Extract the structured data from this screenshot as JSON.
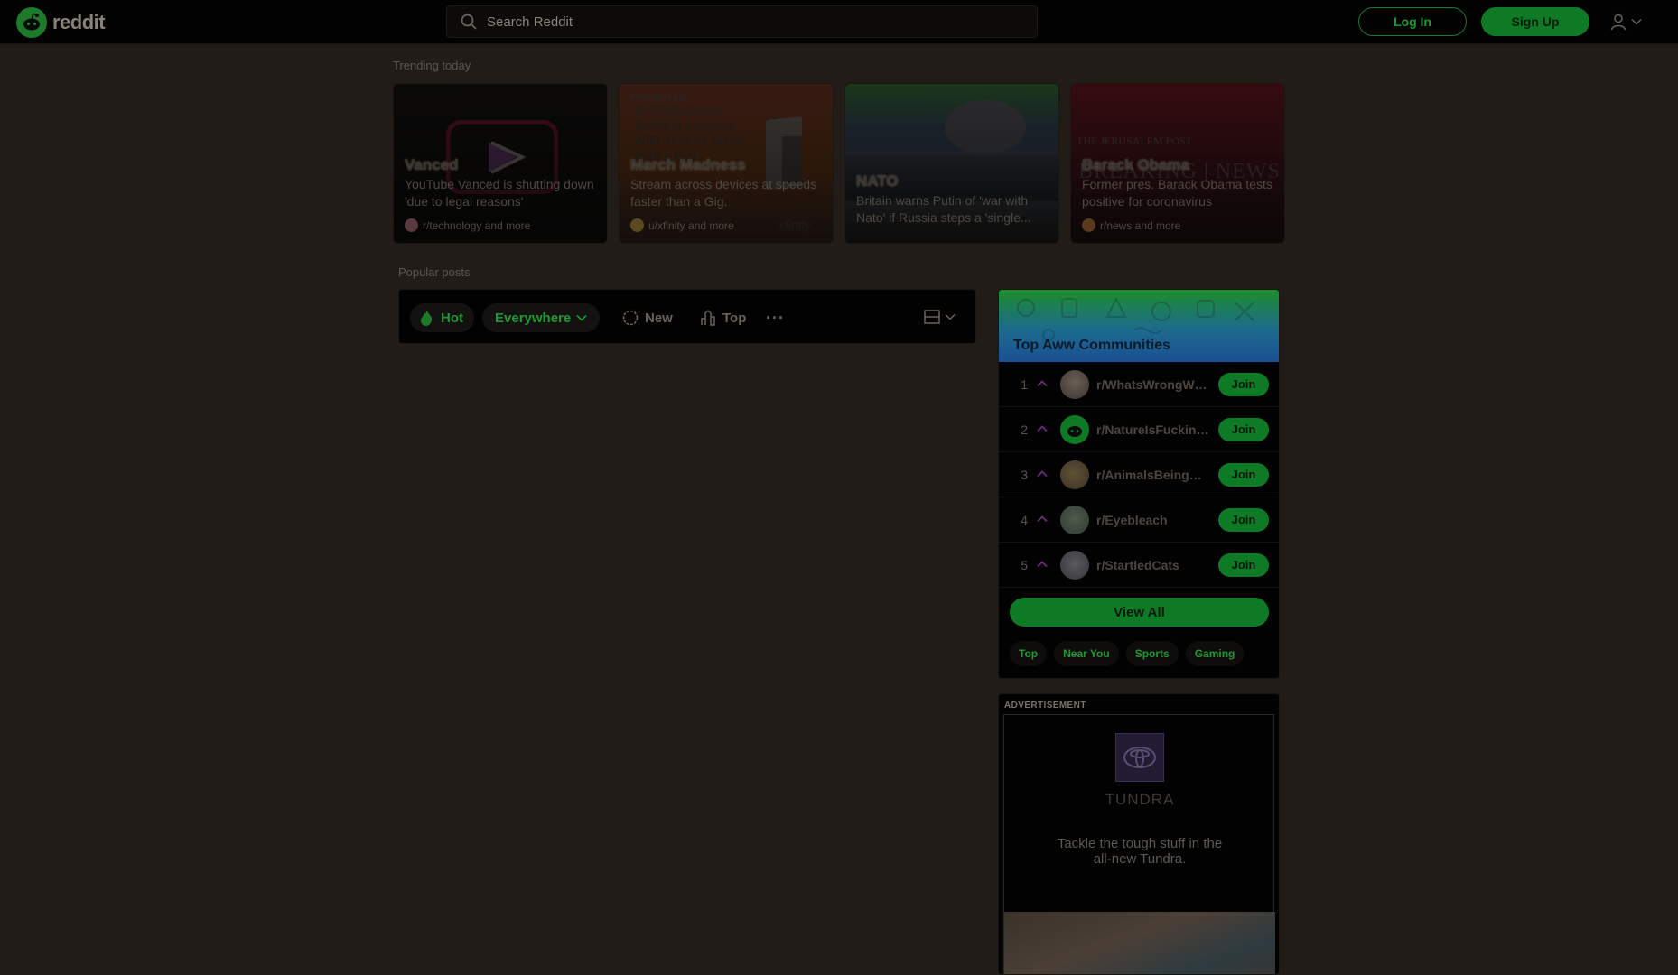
{
  "header": {
    "logo_text": "reddit",
    "search_placeholder": "Search Reddit",
    "login_label": "Log In",
    "signup_label": "Sign Up"
  },
  "trending": {
    "label": "Trending today",
    "cards": [
      {
        "title": "Vanced",
        "description": "YouTube Vanced is shutting down 'due to legal reasons'",
        "subreddit": "r/technology and more",
        "promoted": ""
      },
      {
        "title": "March Madness",
        "description": "Stream across devices at speeds faster than a Gig.",
        "subreddit": "u/xfinity and more",
        "promoted": "PROMOTED"
      },
      {
        "title": "NATO",
        "description": "Britain warns Putin of 'war with Nato' if Russia steps a 'single...",
        "subreddit": "",
        "promoted": ""
      },
      {
        "title": "Barack Obama",
        "description": "Former pres. Barack Obama tests positive for coronavirus",
        "subreddit": "r/news and more",
        "promoted": ""
      }
    ]
  },
  "popular": {
    "label": "Popular posts",
    "sort": {
      "hot": "Hot",
      "everywhere": "Everywhere",
      "new": "New",
      "top": "Top",
      "more": "···"
    }
  },
  "communities": {
    "title": "Top Aww Communities",
    "items": [
      {
        "rank": "1",
        "name": "r/WhatsWrongWithYourDog",
        "join": "Join"
      },
      {
        "rank": "2",
        "name": "r/NatureIsFuckingLit",
        "join": "Join"
      },
      {
        "rank": "3",
        "name": "r/AnimalsBeingBros",
        "join": "Join"
      },
      {
        "rank": "4",
        "name": "r/Eyebleach",
        "join": "Join"
      },
      {
        "rank": "5",
        "name": "r/StartledCats",
        "join": "Join"
      }
    ],
    "view_all": "View All",
    "chips": [
      "Top",
      "Near You",
      "Sports",
      "Gaming"
    ]
  },
  "ad": {
    "label": "ADVERTISEMENT",
    "brand": "TUNDRA",
    "copy": "Tackle the tough stuff in the all-new Tundra."
  },
  "colors": {
    "background": "#211c17",
    "header": "#020202",
    "accent_green": "#1c7a2a",
    "upvote": "#6b2a7a"
  }
}
